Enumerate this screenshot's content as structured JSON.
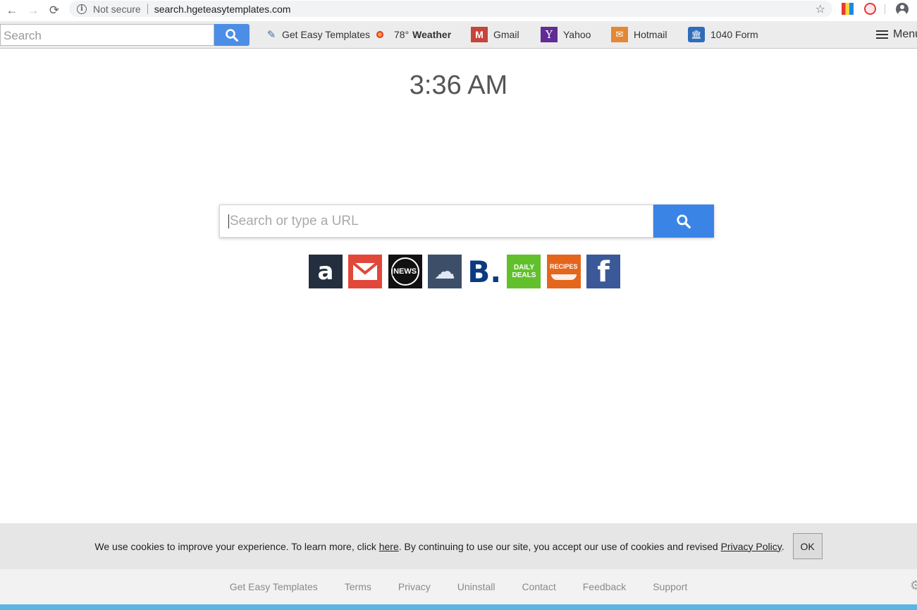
{
  "browser": {
    "back_icon": "←",
    "forward_icon": "→",
    "reload_icon": "⟳",
    "info_icon": "i",
    "security_label": "Not secure",
    "url": "search.hgeteasytemplates.com",
    "star_icon": "☆"
  },
  "toolbar": {
    "search_placeholder": "Search",
    "links": [
      {
        "label": "Get Easy Templates",
        "icon": "✎"
      },
      {
        "temp": "78°",
        "label": "Weather"
      },
      {
        "label": "Gmail",
        "icon": "M"
      },
      {
        "label": "Yahoo",
        "icon": "Y"
      },
      {
        "label": "Hotmail",
        "icon": "✉"
      },
      {
        "label": "1040 Form",
        "icon": "🏛"
      }
    ],
    "menu_label": "Menu"
  },
  "main": {
    "clock": "3:36 AM",
    "search_placeholder": "Search or type a URL",
    "tiles": [
      {
        "name": "amazon",
        "glyph": "a"
      },
      {
        "name": "gmail",
        "glyph": "M"
      },
      {
        "name": "news",
        "glyph": "NEWS"
      },
      {
        "name": "weather",
        "glyph": "☁"
      },
      {
        "name": "booking",
        "glyph": "B."
      },
      {
        "name": "daily-deals",
        "glyph": "DAILY DEALS"
      },
      {
        "name": "recipes",
        "glyph": "RECIPES"
      },
      {
        "name": "facebook",
        "glyph": "f"
      }
    ]
  },
  "cookie": {
    "text_before": "We use cookies to improve your experience. To learn more, click ",
    "here_link": "here",
    "text_middle": ". By continuing to use our site, you accept our use of cookies and revised ",
    "policy_link": "Privacy Policy",
    "text_after": ".",
    "ok_label": "OK"
  },
  "footer": {
    "links": [
      "Get Easy Templates",
      "Terms",
      "Privacy",
      "Uninstall",
      "Contact",
      "Feedback",
      "Support"
    ]
  },
  "colors": {
    "accent_blue": "#3a84e6",
    "footer_bar": "#5cb6e4"
  }
}
